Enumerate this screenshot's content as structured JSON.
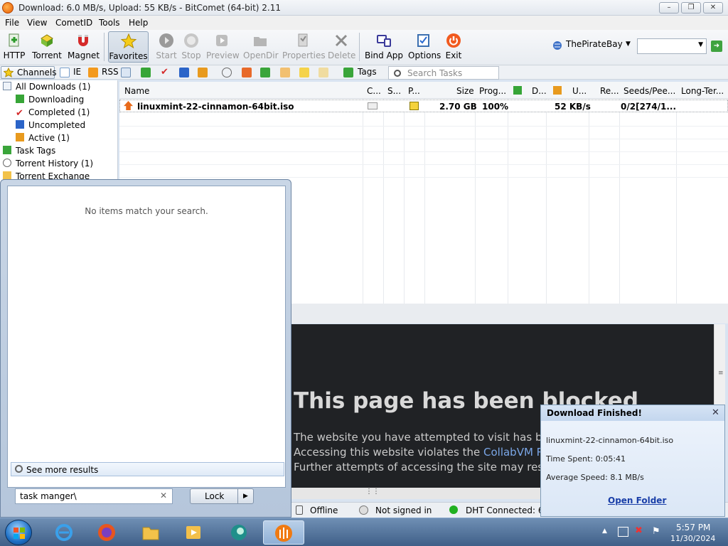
{
  "window": {
    "title": "Download: 6.0 MB/s, Upload: 55 KB/s - BitComet (64-bit) 2.11"
  },
  "menu": [
    "File",
    "View",
    "CometID",
    "Tools",
    "Help"
  ],
  "toolbar": {
    "http": "HTTP",
    "torrent": "Torrent",
    "magnet": "Magnet",
    "favorites": "Favorites",
    "start": "Start",
    "stop": "Stop",
    "preview": "Preview",
    "opendir": "OpenDir",
    "properties": "Properties",
    "delete": "Delete",
    "bind_app": "Bind App",
    "options": "Options",
    "exit": "Exit",
    "search_site": "ThePirateBay"
  },
  "toolbar2": {
    "channels": "Channels",
    "ie": "IE",
    "rss": "RSS",
    "tags": "Tags",
    "search_placeholder": "Search Tasks"
  },
  "sidebar": {
    "items": [
      {
        "label": "All Downloads (1)"
      },
      {
        "label": "Downloading"
      },
      {
        "label": "Completed (1)"
      },
      {
        "label": "Uncompleted"
      },
      {
        "label": "Active (1)"
      },
      {
        "label": "Task Tags"
      },
      {
        "label": "Torrent History (1)"
      },
      {
        "label": "Torrent Exchange"
      }
    ]
  },
  "tasklist": {
    "columns": [
      "Name",
      "C...",
      "S...",
      "P...",
      "Size",
      "Prog...",
      "D...",
      "U...",
      "Re...",
      "Seeds/Pee...",
      "Long-Ter..."
    ],
    "row": {
      "name": "linuxmint-22-cinnamon-64bit.iso",
      "size": "2.70 GB",
      "progress": "100%",
      "upload": "52 KB/s",
      "seeds": "0/2[274/1..."
    }
  },
  "browser": {
    "title": "This page has been blocked",
    "line1": "The website you have attempted to visit has been b",
    "line2_pre": "Accessing this website violates the ",
    "line2_link": "CollabVM Rules",
    "line3": "Further attempts of accessing the site may result in"
  },
  "statusbar": {
    "offline": "Offline",
    "signin": "Not signed in",
    "dht": "DHT Connected: 68"
  },
  "notification": {
    "title": "Download Finished!",
    "file": "linuxmint-22-cinnamon-64bit.iso",
    "time": "Time Spent: 0:05:41",
    "speed": "Average Speed: 8.1 MB/s",
    "open_folder": "Open Folder"
  },
  "startmenu": {
    "no_items": "No items match your search.",
    "see_more": "See more results",
    "search_value": "task manger\\",
    "lock": "Lock"
  },
  "taskbar": {
    "time": "5:57 PM",
    "date": "11/30/2024"
  },
  "colors": {
    "accent": "#3f5f88",
    "blocked_bg": "#202225",
    "link": "#7aa6e6"
  }
}
